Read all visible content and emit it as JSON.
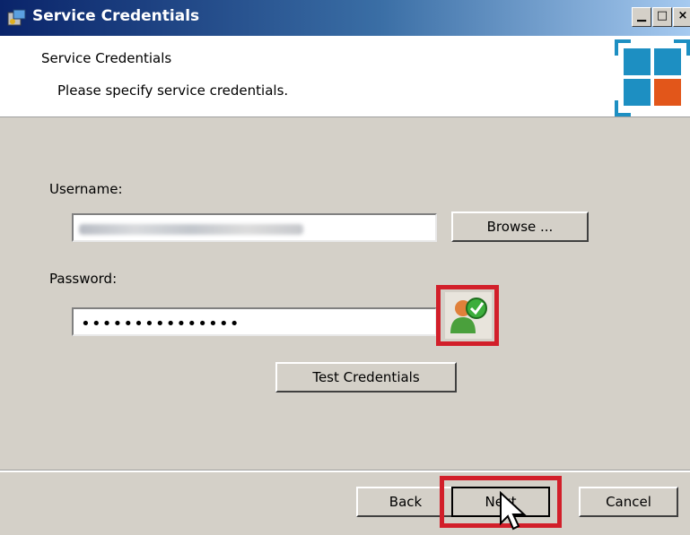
{
  "window": {
    "title": "Service Credentials"
  },
  "header": {
    "title": "Service Credentials",
    "subtitle": "Please specify service credentials."
  },
  "form": {
    "username_label": "Username:",
    "username_value": "PostPointServiceDemo@daten.local",
    "browse_label": "Browse ...",
    "password_label": "Password:",
    "password_value": "•••••••••••••••",
    "test_label": "Test Credentials"
  },
  "footer": {
    "back_label": "Back",
    "next_label": "Next",
    "cancel_label": "Cancel"
  },
  "icons": {
    "app": "installer-icon",
    "logo": "product-logo-icon",
    "credential_status": "user-verified-icon"
  },
  "colors": {
    "highlight": "#d21f2a",
    "logo_blue": "#1d8fc2",
    "logo_orange": "#e2561a"
  }
}
